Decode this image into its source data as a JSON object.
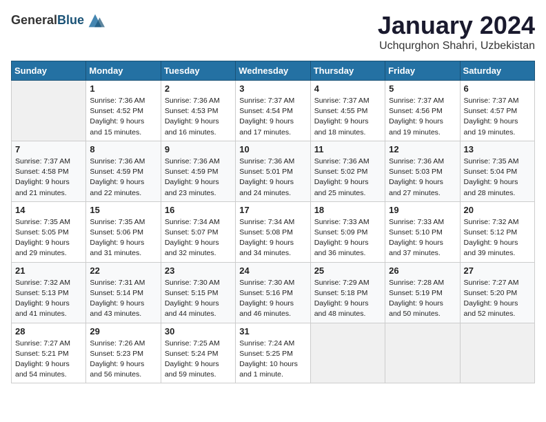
{
  "header": {
    "logo_general": "General",
    "logo_blue": "Blue",
    "title": "January 2024",
    "subtitle": "Uchqurghon Shahri, Uzbekistan"
  },
  "weekdays": [
    "Sunday",
    "Monday",
    "Tuesday",
    "Wednesday",
    "Thursday",
    "Friday",
    "Saturday"
  ],
  "weeks": [
    [
      {
        "day": "",
        "info": ""
      },
      {
        "day": "1",
        "info": "Sunrise: 7:36 AM\nSunset: 4:52 PM\nDaylight: 9 hours\nand 15 minutes."
      },
      {
        "day": "2",
        "info": "Sunrise: 7:36 AM\nSunset: 4:53 PM\nDaylight: 9 hours\nand 16 minutes."
      },
      {
        "day": "3",
        "info": "Sunrise: 7:37 AM\nSunset: 4:54 PM\nDaylight: 9 hours\nand 17 minutes."
      },
      {
        "day": "4",
        "info": "Sunrise: 7:37 AM\nSunset: 4:55 PM\nDaylight: 9 hours\nand 18 minutes."
      },
      {
        "day": "5",
        "info": "Sunrise: 7:37 AM\nSunset: 4:56 PM\nDaylight: 9 hours\nand 19 minutes."
      },
      {
        "day": "6",
        "info": "Sunrise: 7:37 AM\nSunset: 4:57 PM\nDaylight: 9 hours\nand 19 minutes."
      }
    ],
    [
      {
        "day": "7",
        "info": "Sunrise: 7:37 AM\nSunset: 4:58 PM\nDaylight: 9 hours\nand 21 minutes."
      },
      {
        "day": "8",
        "info": "Sunrise: 7:36 AM\nSunset: 4:59 PM\nDaylight: 9 hours\nand 22 minutes."
      },
      {
        "day": "9",
        "info": "Sunrise: 7:36 AM\nSunset: 4:59 PM\nDaylight: 9 hours\nand 23 minutes."
      },
      {
        "day": "10",
        "info": "Sunrise: 7:36 AM\nSunset: 5:01 PM\nDaylight: 9 hours\nand 24 minutes."
      },
      {
        "day": "11",
        "info": "Sunrise: 7:36 AM\nSunset: 5:02 PM\nDaylight: 9 hours\nand 25 minutes."
      },
      {
        "day": "12",
        "info": "Sunrise: 7:36 AM\nSunset: 5:03 PM\nDaylight: 9 hours\nand 27 minutes."
      },
      {
        "day": "13",
        "info": "Sunrise: 7:35 AM\nSunset: 5:04 PM\nDaylight: 9 hours\nand 28 minutes."
      }
    ],
    [
      {
        "day": "14",
        "info": "Sunrise: 7:35 AM\nSunset: 5:05 PM\nDaylight: 9 hours\nand 29 minutes."
      },
      {
        "day": "15",
        "info": "Sunrise: 7:35 AM\nSunset: 5:06 PM\nDaylight: 9 hours\nand 31 minutes."
      },
      {
        "day": "16",
        "info": "Sunrise: 7:34 AM\nSunset: 5:07 PM\nDaylight: 9 hours\nand 32 minutes."
      },
      {
        "day": "17",
        "info": "Sunrise: 7:34 AM\nSunset: 5:08 PM\nDaylight: 9 hours\nand 34 minutes."
      },
      {
        "day": "18",
        "info": "Sunrise: 7:33 AM\nSunset: 5:09 PM\nDaylight: 9 hours\nand 36 minutes."
      },
      {
        "day": "19",
        "info": "Sunrise: 7:33 AM\nSunset: 5:10 PM\nDaylight: 9 hours\nand 37 minutes."
      },
      {
        "day": "20",
        "info": "Sunrise: 7:32 AM\nSunset: 5:12 PM\nDaylight: 9 hours\nand 39 minutes."
      }
    ],
    [
      {
        "day": "21",
        "info": "Sunrise: 7:32 AM\nSunset: 5:13 PM\nDaylight: 9 hours\nand 41 minutes."
      },
      {
        "day": "22",
        "info": "Sunrise: 7:31 AM\nSunset: 5:14 PM\nDaylight: 9 hours\nand 43 minutes."
      },
      {
        "day": "23",
        "info": "Sunrise: 7:30 AM\nSunset: 5:15 PM\nDaylight: 9 hours\nand 44 minutes."
      },
      {
        "day": "24",
        "info": "Sunrise: 7:30 AM\nSunset: 5:16 PM\nDaylight: 9 hours\nand 46 minutes."
      },
      {
        "day": "25",
        "info": "Sunrise: 7:29 AM\nSunset: 5:18 PM\nDaylight: 9 hours\nand 48 minutes."
      },
      {
        "day": "26",
        "info": "Sunrise: 7:28 AM\nSunset: 5:19 PM\nDaylight: 9 hours\nand 50 minutes."
      },
      {
        "day": "27",
        "info": "Sunrise: 7:27 AM\nSunset: 5:20 PM\nDaylight: 9 hours\nand 52 minutes."
      }
    ],
    [
      {
        "day": "28",
        "info": "Sunrise: 7:27 AM\nSunset: 5:21 PM\nDaylight: 9 hours\nand 54 minutes."
      },
      {
        "day": "29",
        "info": "Sunrise: 7:26 AM\nSunset: 5:23 PM\nDaylight: 9 hours\nand 56 minutes."
      },
      {
        "day": "30",
        "info": "Sunrise: 7:25 AM\nSunset: 5:24 PM\nDaylight: 9 hours\nand 59 minutes."
      },
      {
        "day": "31",
        "info": "Sunrise: 7:24 AM\nSunset: 5:25 PM\nDaylight: 10 hours\nand 1 minute."
      },
      {
        "day": "",
        "info": ""
      },
      {
        "day": "",
        "info": ""
      },
      {
        "day": "",
        "info": ""
      }
    ]
  ]
}
